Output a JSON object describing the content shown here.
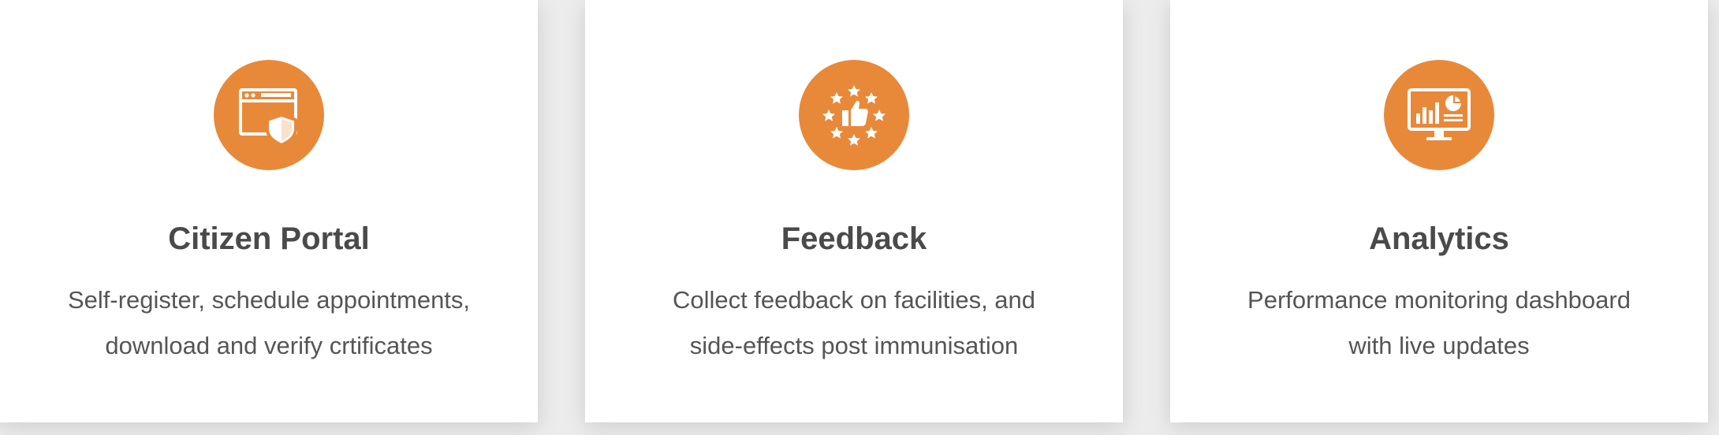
{
  "theme": {
    "accent": "#e8893a",
    "card_background": "#ffffff",
    "page_background": "#ececec",
    "title_color": "#4a4a4a",
    "text_color": "#555555"
  },
  "features": [
    {
      "icon": "browser-shield-icon",
      "title": "Citizen Portal",
      "description_line1": "Self-register, schedule appointments,",
      "description_line2": "download and verify crtificates"
    },
    {
      "icon": "thumbs-up-stars-icon",
      "title": "Feedback",
      "description_line1": "Collect feedback on facilities, and",
      "description_line2": "side-effects post immunisation"
    },
    {
      "icon": "monitor-analytics-icon",
      "title": "Analytics",
      "description_line1": "Performance monitoring dashboard",
      "description_line2": "with live updates"
    }
  ]
}
